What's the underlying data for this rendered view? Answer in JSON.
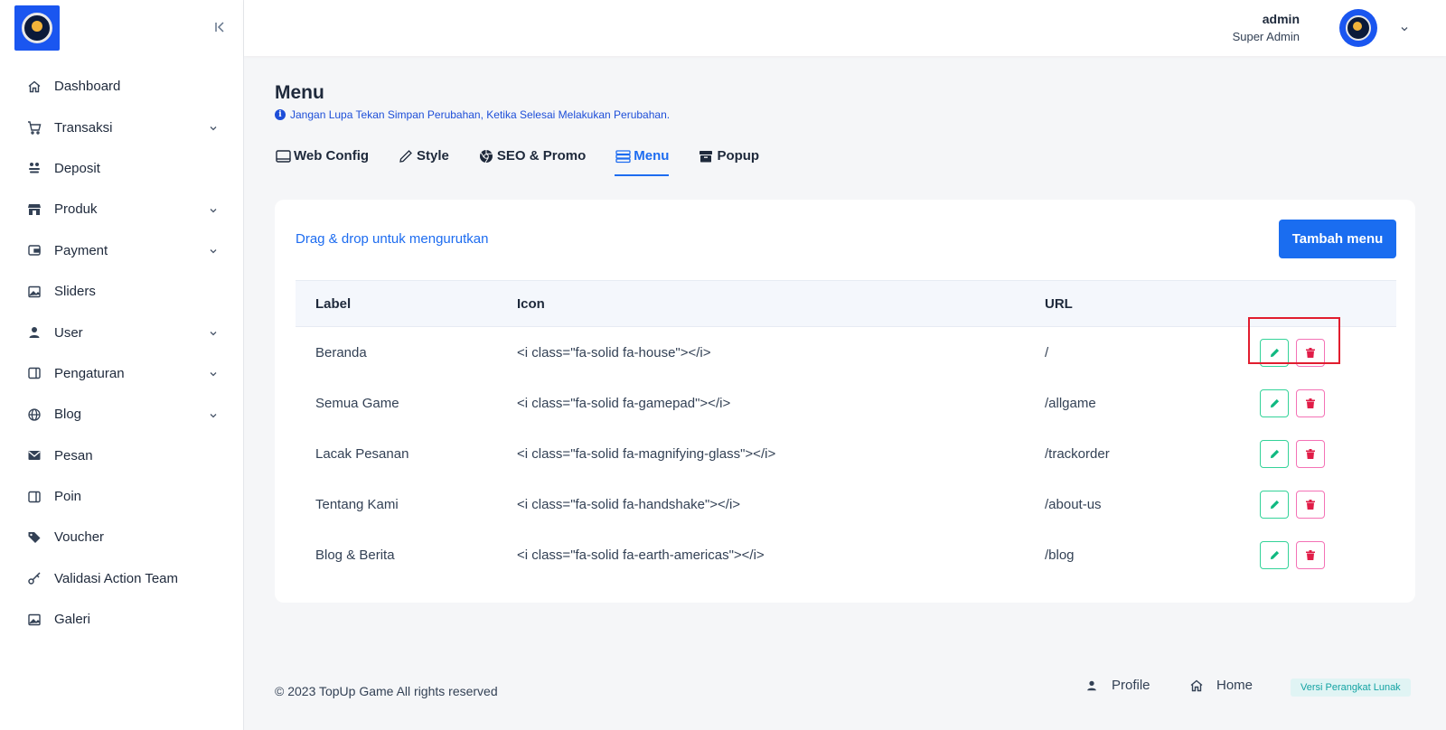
{
  "sidebar": {
    "items": [
      {
        "label": "Dashboard",
        "icon": "home-icon",
        "has_children": false
      },
      {
        "label": "Transaksi",
        "icon": "cart-icon",
        "has_children": true
      },
      {
        "label": "Deposit",
        "icon": "coins-icon",
        "has_children": false
      },
      {
        "label": "Produk",
        "icon": "store-icon",
        "has_children": true
      },
      {
        "label": "Payment",
        "icon": "wallet-icon",
        "has_children": true
      },
      {
        "label": "Sliders",
        "icon": "image-icon",
        "has_children": false
      },
      {
        "label": "User",
        "icon": "user-icon",
        "has_children": true
      },
      {
        "label": "Pengaturan",
        "icon": "panel-icon",
        "has_children": true
      },
      {
        "label": "Blog",
        "icon": "globe-icon",
        "has_children": true
      },
      {
        "label": "Pesan",
        "icon": "mail-icon",
        "has_children": false
      },
      {
        "label": "Poin",
        "icon": "panel-icon",
        "has_children": false
      },
      {
        "label": "Voucher",
        "icon": "tags-icon",
        "has_children": false
      },
      {
        "label": "Validasi Action Team",
        "icon": "key-icon",
        "has_children": false
      },
      {
        "label": "Galeri",
        "icon": "image-icon",
        "has_children": false
      }
    ]
  },
  "header": {
    "user_name": "admin",
    "user_role": "Super Admin"
  },
  "page": {
    "title": "Menu",
    "notice": "Jangan Lupa Tekan Simpan Perubahan, Ketika Selesai Melakukan Perubahan.",
    "tabs": [
      {
        "label": "Web Config",
        "icon": "config-icon",
        "active": false
      },
      {
        "label": "Style",
        "icon": "pen-icon",
        "active": false
      },
      {
        "label": "SEO & Promo",
        "icon": "chrome-icon",
        "active": false
      },
      {
        "label": "Menu",
        "icon": "menu-list-icon",
        "active": true
      },
      {
        "label": "Popup",
        "icon": "archive-icon",
        "active": false
      }
    ]
  },
  "card": {
    "drag_hint": "Drag & drop untuk mengurutkan",
    "add_button": "Tambah menu",
    "columns": {
      "label": "Label",
      "icon": "Icon",
      "url": "URL"
    },
    "rows": [
      {
        "label": "Beranda",
        "icon": "<i class=\"fa-solid fa-house\"></i>",
        "url": "/"
      },
      {
        "label": "Semua Game",
        "icon": "<i class=\"fa-solid fa-gamepad\"></i>",
        "url": "/allgame"
      },
      {
        "label": "Lacak Pesanan",
        "icon": "<i class=\"fa-solid fa-magnifying-glass\"></i>",
        "url": "/trackorder"
      },
      {
        "label": "Tentang Kami",
        "icon": "<i class=\"fa-solid fa-handshake\"></i>",
        "url": "/about-us"
      },
      {
        "label": "Blog & Berita",
        "icon": "<i class=\"fa-solid fa-earth-americas\"></i>",
        "url": "/blog"
      }
    ]
  },
  "footer": {
    "copyright": "© 2023 TopUp Game All rights reserved",
    "profile_link": "Profile",
    "home_link": "Home",
    "version_badge": "Versi Perangkat Lunak"
  },
  "colors": {
    "accent": "#1a6df0",
    "edit": "#10b981",
    "delete": "#e11d48",
    "highlight": "#e11d2e"
  }
}
